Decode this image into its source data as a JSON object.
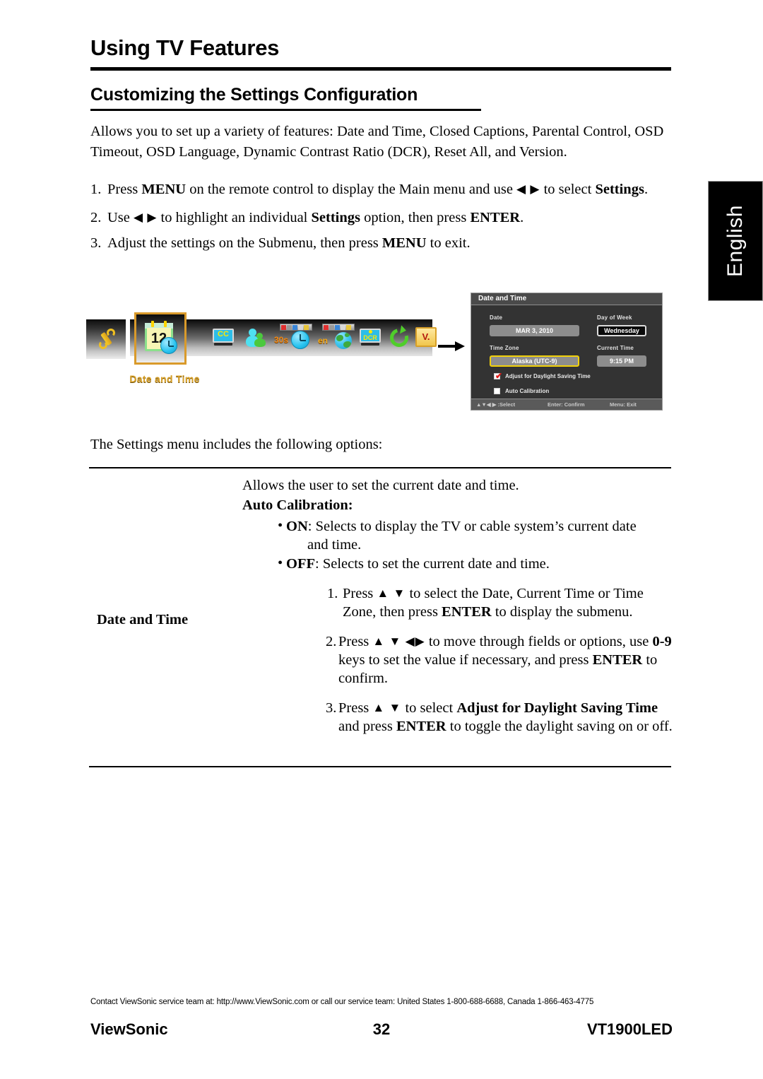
{
  "page": {
    "chapter_title": "Using TV Features",
    "section_title": "Customizing the Settings Configuration",
    "intro": "Allows you to set up a variety of features: Date and Time, Closed Captions, Parental Control, OSD Timeout, OSD Language, Dynamic Contrast Ratio (DCR), Reset All, and Version.",
    "after_figure": "The Settings menu includes the following options:",
    "language_tab": "English"
  },
  "steps": [
    {
      "num": "1.",
      "html": "Press <b>MENU</b> on the remote control to display the Main menu and use <span class=\"arrglyph\">◀ ▶</span> to select <b>Settings</b>."
    },
    {
      "num": "2.",
      "html": "Use <span class=\"arrglyph\">◀ ▶</span> to highlight an individual <b>Settings</b> option, then press <b>ENTER</b>."
    },
    {
      "num": "3.",
      "html": "Adjust the settings on the Submenu, then press <b>MENU</b> to exit."
    }
  ],
  "figure": {
    "selected_label": "Date and Time",
    "arrow": "right-arrow",
    "icons": [
      {
        "name": "wrench-icon",
        "label": ""
      },
      {
        "name": "date-and-time-icon",
        "label": "12"
      },
      {
        "name": "closed-captions-icon",
        "label": "CC"
      },
      {
        "name": "parental-control-icon",
        "label": ""
      },
      {
        "name": "osd-timeout-icon",
        "label": "30s"
      },
      {
        "name": "osd-language-icon",
        "label": "en"
      },
      {
        "name": "dcr-icon",
        "label": "DCR"
      },
      {
        "name": "reset-all-icon",
        "label": ""
      },
      {
        "name": "version-icon",
        "label": "V."
      }
    ]
  },
  "osd": {
    "title": "Date and Time",
    "fields": {
      "date_label": "Date",
      "date_value": "MAR 3, 2010",
      "day_label": "Day of Week",
      "day_value": "Wednesday",
      "timezone_label": "Time Zone",
      "timezone_value": "Alaska (UTC-9)",
      "current_time_label": "Current Time",
      "current_time_value": "9:15 PM"
    },
    "checkboxes": [
      {
        "label": "Adjust for Daylight Saving Time",
        "checked": true
      },
      {
        "label": "Auto Calibration",
        "checked": false
      }
    ],
    "footer": {
      "select": "▲▼◀ ▶ :Select",
      "confirm": "Enter: Confirm",
      "exit": "Menu: Exit"
    },
    "colors": {
      "panel": "#333333",
      "titlebar": "#4a4a4a",
      "field": "#8d8d8d",
      "highlight": "#f2d10a",
      "check": "#e21a17"
    }
  },
  "table": {
    "row_label": "Date and Time",
    "desc_line": "Allows the user to set the current date and time.",
    "desc_head": "Auto Calibration:",
    "bullets": [
      {
        "dot": "•",
        "html": "<b>ON</b>: Selects to display the TV or cable system’s current date <span class=\"ind\">and time.</span>"
      },
      {
        "dot": "•",
        "html": "<b>OFF</b>: Selects to set the current date and time."
      }
    ],
    "numbered": [
      {
        "num": "1.",
        "html": "Press <span class=\"arrglyph\">▲ ▼</span> to select the Date, Current Time or Time Zone, then press <b>ENTER</b> to display the submenu."
      },
      {
        "num": "2.",
        "html": "Press <span class=\"arrglyph\">▲ ▼ ◀▶</span> to move through fields or options, use <b>0-9</b> keys to set the value if necessary, and press <b>ENTER</b> to confirm."
      },
      {
        "num": "3.",
        "html": "Press <span class=\"arrglyph\">▲ ▼</span> to select <b>Adjust for Daylight Saving Time</b> and press <b>ENTER</b> to toggle the daylight saving on or off."
      }
    ]
  },
  "footer": {
    "contact": "Contact ViewSonic service team at: http://www.ViewSonic.com or call our service team: United States 1-800-688-6688, Canada 1-866-463-4775",
    "brand": "ViewSonic",
    "page_number": "32",
    "model": "VT1900LED"
  }
}
